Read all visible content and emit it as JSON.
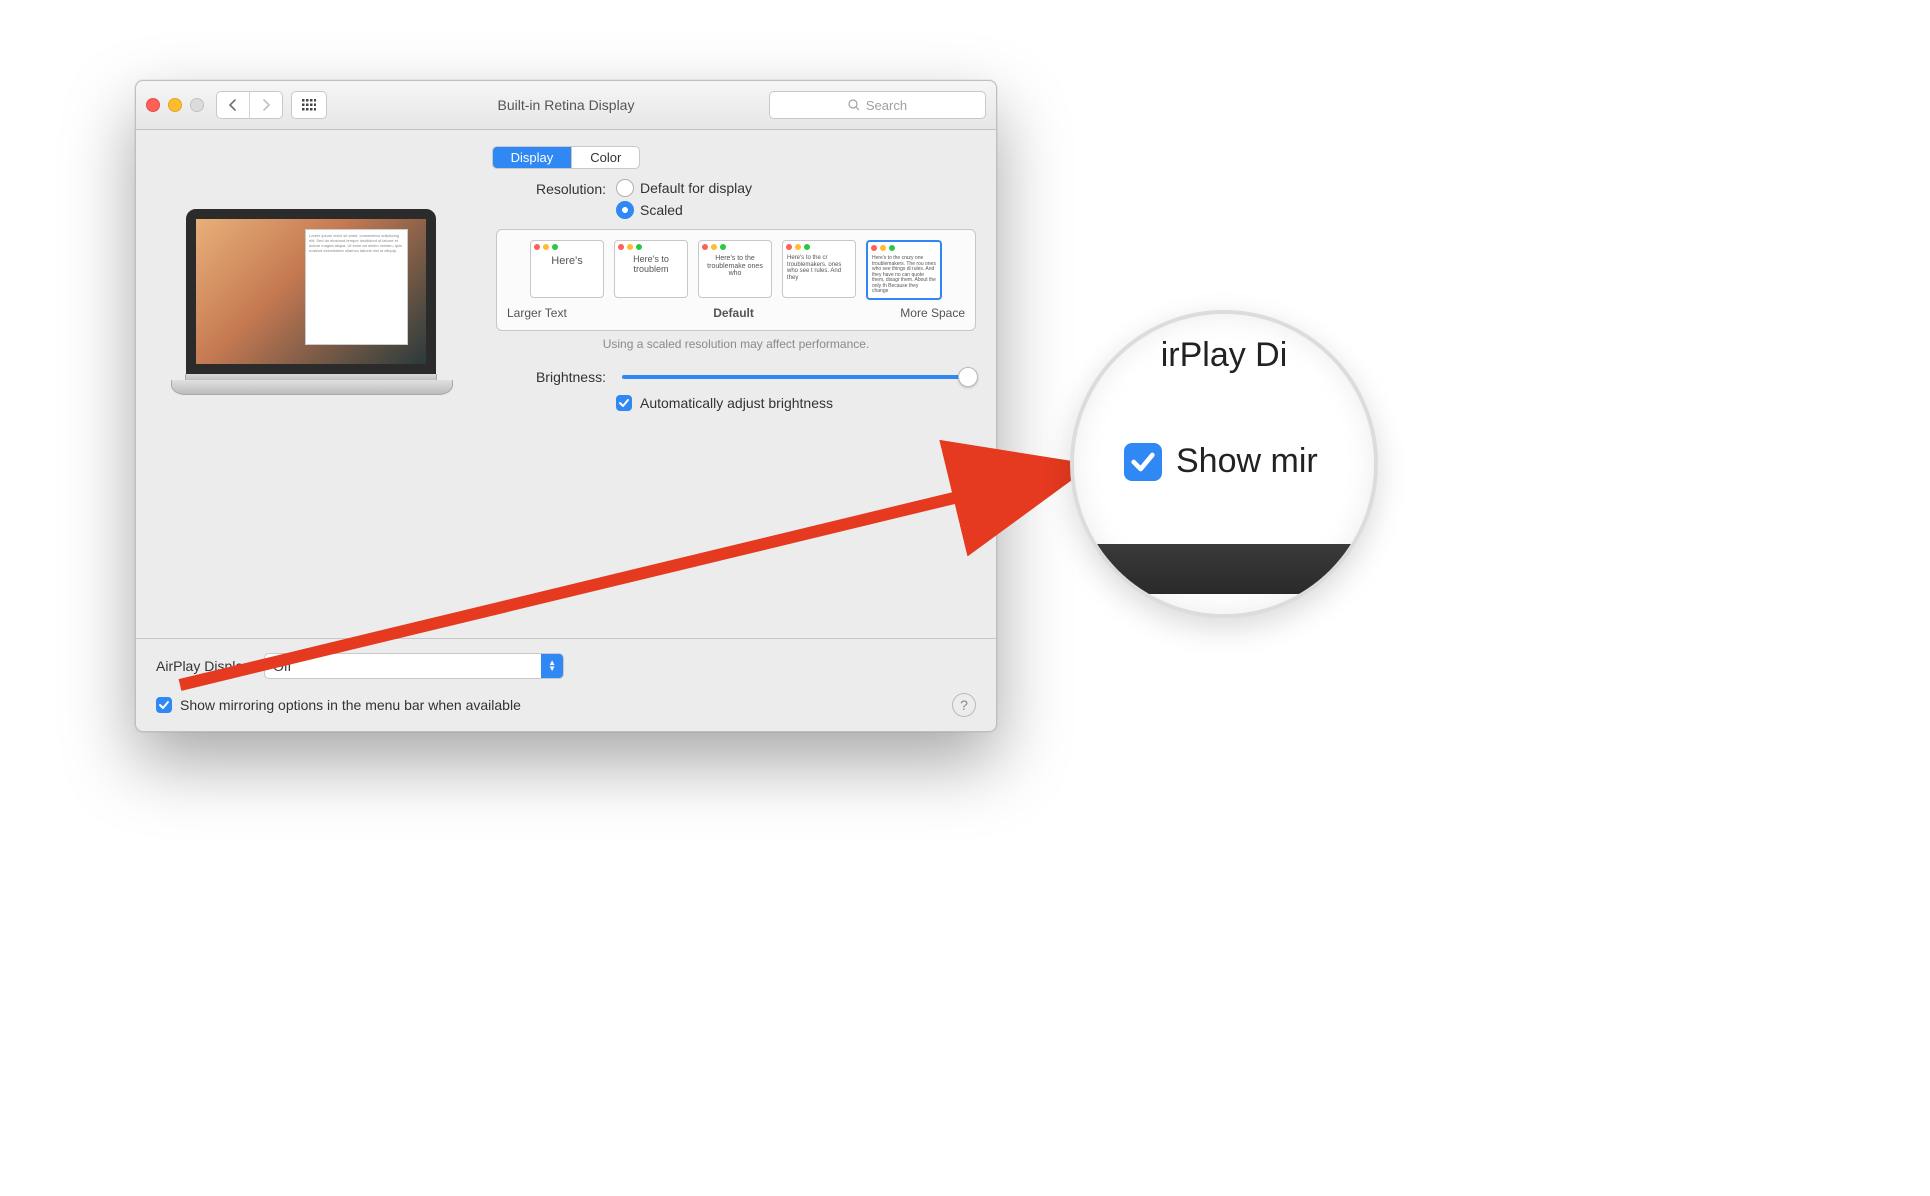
{
  "window": {
    "title": "Built-in Retina Display",
    "search_placeholder": "Search"
  },
  "tabs": [
    {
      "label": "Display",
      "active": true
    },
    {
      "label": "Color",
      "active": false
    }
  ],
  "resolution": {
    "label": "Resolution:",
    "options": [
      {
        "label": "Default for display",
        "selected": false
      },
      {
        "label": "Scaled",
        "selected": true
      }
    ],
    "scale_thumbs": [
      {
        "text": "Here's"
      },
      {
        "text": "Here's to troublem"
      },
      {
        "text": "Here's to the troublemake ones who"
      },
      {
        "text": "Here's to the cr troublemakers. ones who see t rules. And they"
      },
      {
        "text": "Here's to the crazy one troublemakers. The rou ones who see things di rules. And they have no can quote them, disagr them. About the only th Because they change"
      }
    ],
    "scale_labels": {
      "left": "Larger Text",
      "mid": "Default",
      "right": "More Space"
    },
    "note": "Using a scaled resolution may affect performance."
  },
  "brightness": {
    "label": "Brightness:",
    "auto_label": "Automatically adjust brightness",
    "value_percent": 97
  },
  "airplay": {
    "label": "AirPlay Display:",
    "selected": "Off"
  },
  "mirroring": {
    "label": "Show mirroring options in the menu bar when available",
    "checked": true
  },
  "magnifier": {
    "top_text": "irPlay Di",
    "label": "Show mir"
  }
}
